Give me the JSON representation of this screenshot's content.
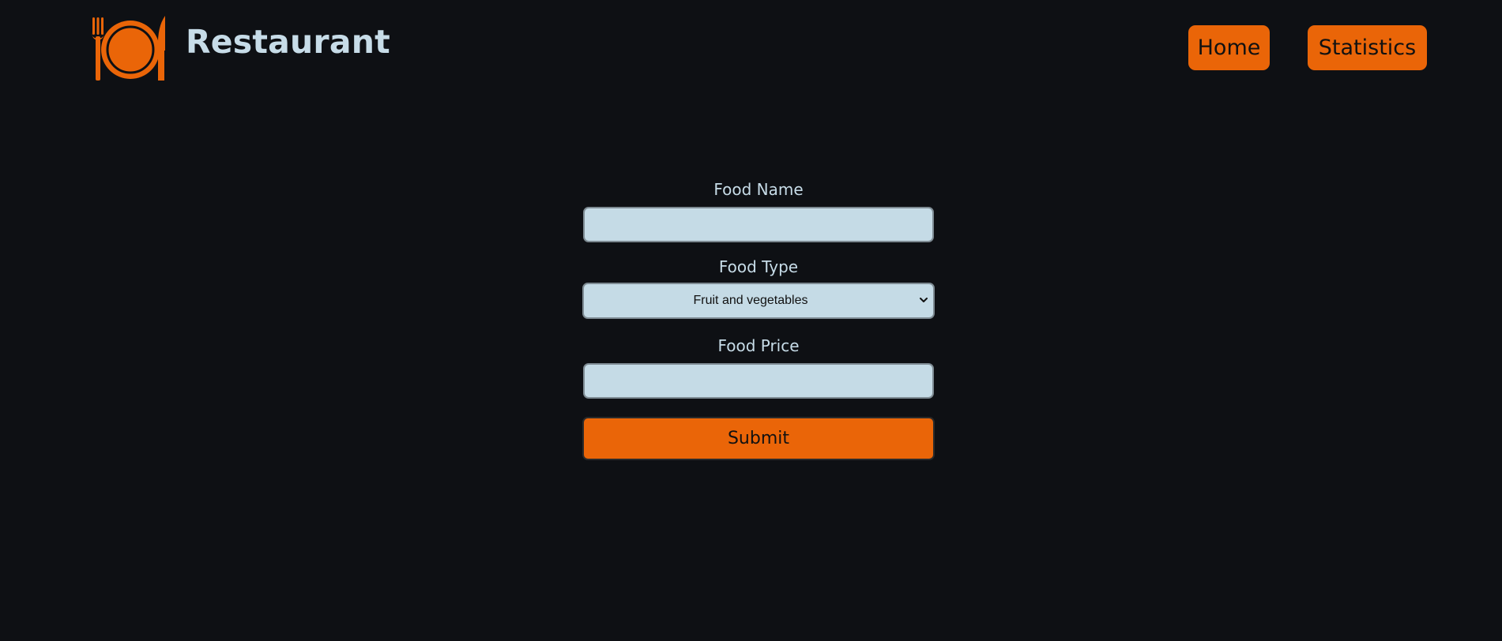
{
  "brand": {
    "title": "Restaurant",
    "logo_icon": "plate-fork-knife-icon"
  },
  "nav": {
    "home_label": "Home",
    "statistics_label": "Statistics"
  },
  "form": {
    "food_name_label": "Food Name",
    "food_name_value": "",
    "food_type_label": "Food Type",
    "food_type_selected": "Fruit and vegetables",
    "food_price_label": "Food Price",
    "food_price_value": "",
    "submit_label": "Submit"
  },
  "colors": {
    "background": "#0e1014",
    "accent": "#ea6508",
    "text_light": "#c7dce8",
    "input_background": "#c5dbe6"
  }
}
